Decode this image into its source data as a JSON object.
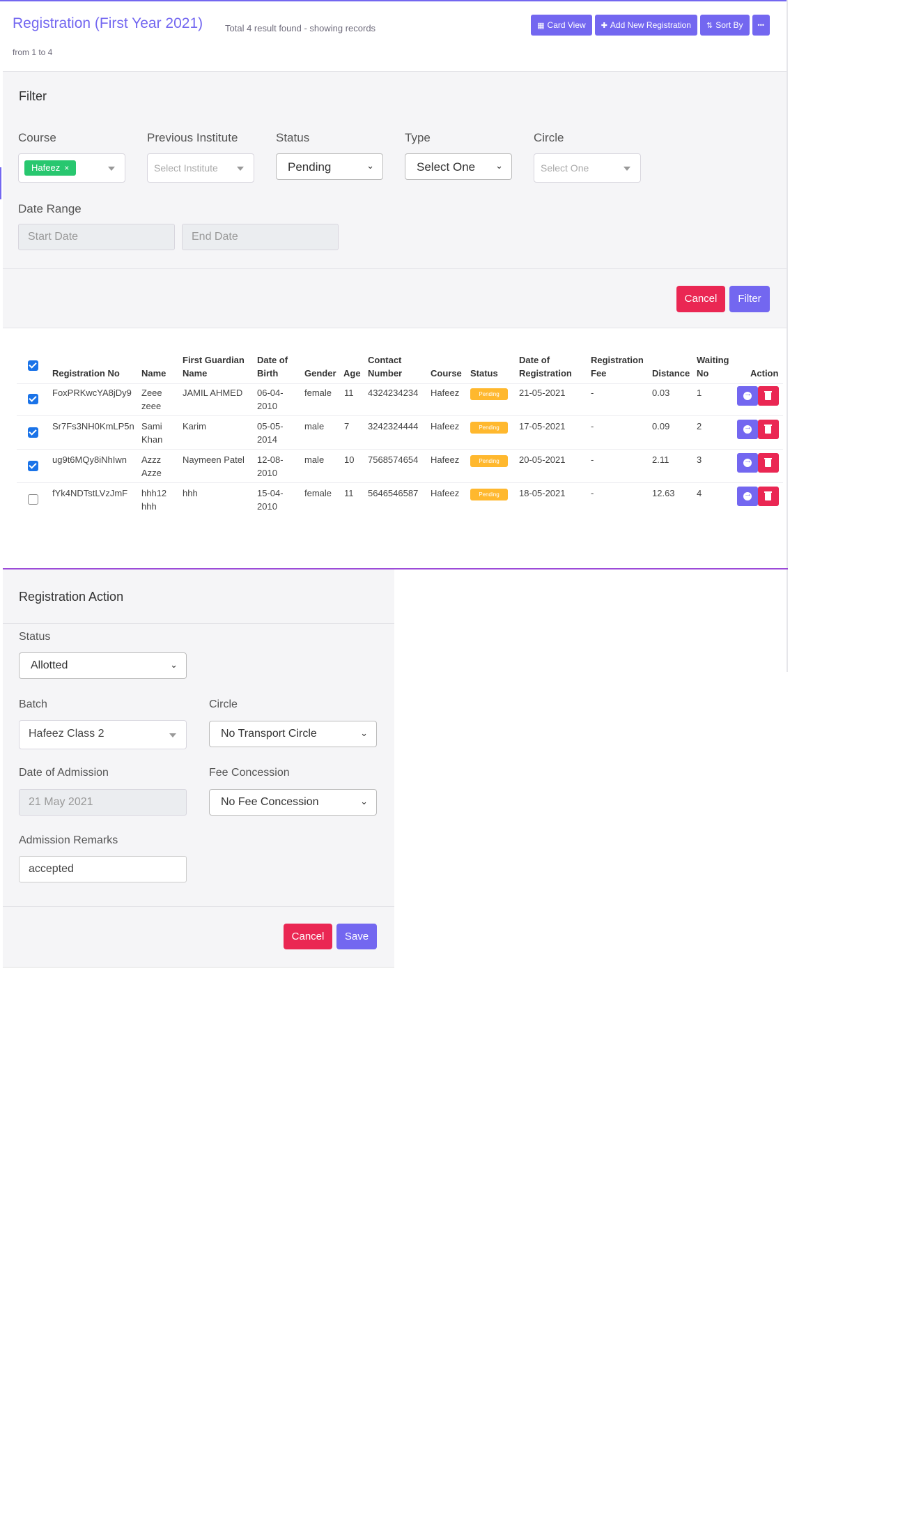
{
  "header": {
    "title": "Registration (First Year 2021)",
    "result_line1": "Total 4 result found - showing records",
    "result_line2": "from 1 to 4",
    "buttons": {
      "card_view": "Card View",
      "add_new": "Add New Registration",
      "sort_by": "Sort By",
      "more": "•••"
    }
  },
  "filter": {
    "title": "Filter",
    "course_label": "Course",
    "course_chip": "Hafeez",
    "prev_institute_label": "Previous Institute",
    "prev_institute_placeholder": "Select Institute",
    "status_label": "Status",
    "status_value": "Pending",
    "type_label": "Type",
    "type_value": "Select One",
    "circle_label": "Circle",
    "circle_placeholder": "Select One",
    "date_range_label": "Date Range",
    "start_placeholder": "Start Date",
    "end_placeholder": "End Date",
    "cancel": "Cancel",
    "filter_btn": "Filter"
  },
  "table": {
    "headers": {
      "reg_no": "Registration No",
      "name": "Name",
      "guardian_1": "First Guardian",
      "guardian_2": "Name",
      "dob_1": "Date of",
      "dob_2": "Birth",
      "gender": "Gender",
      "age": "Age",
      "contact_1": "Contact",
      "contact_2": "Number",
      "course": "Course",
      "status": "Status",
      "doreg_1": "Date of",
      "doreg_2": "Registration",
      "fee_1": "Registration",
      "fee_2": "Fee",
      "distance": "Distance",
      "waiting_1": "Waiting",
      "waiting_2": "No",
      "action": "Action"
    },
    "rows": [
      {
        "checked": true,
        "reg_no": "FoxPRKwcYA8jDy9",
        "name1": "Zeee",
        "name2": "zeee",
        "guardian": "JAMIL AHMED",
        "dob1": "06-04-",
        "dob2": "2010",
        "gender": "female",
        "age": "11",
        "contact": "4324234234",
        "course": "Hafeez",
        "status": "Pending",
        "doreg": "21-05-2021",
        "fee": "-",
        "distance": "0.03",
        "waiting": "1"
      },
      {
        "checked": true,
        "reg_no": "Sr7Fs3NH0KmLP5n",
        "name1": "Sami",
        "name2": "Khan",
        "guardian": "Karim",
        "dob1": "05-05-",
        "dob2": "2014",
        "gender": "male",
        "age": "7",
        "contact": "3242324444",
        "course": "Hafeez",
        "status": "Pending",
        "doreg": "17-05-2021",
        "fee": "-",
        "distance": "0.09",
        "waiting": "2"
      },
      {
        "checked": true,
        "reg_no": "ug9t6MQy8iNhIwn",
        "name1": "Azzz",
        "name2": "Azze",
        "guardian": "Naymeen Patel",
        "dob1": "12-08-",
        "dob2": "2010",
        "gender": "male",
        "age": "10",
        "contact": "7568574654",
        "course": "Hafeez",
        "status": "Pending",
        "doreg": "20-05-2021",
        "fee": "-",
        "distance": "2.11",
        "waiting": "3"
      },
      {
        "checked": false,
        "reg_no": "fYk4NDTstLVzJmF",
        "name1": "hhh12",
        "name2": "hhh",
        "guardian": "hhh",
        "dob1": "15-04-",
        "dob2": "2010",
        "gender": "female",
        "age": "11",
        "contact": "5646546587",
        "course": "Hafeez",
        "status": "Pending",
        "doreg": "18-05-2021",
        "fee": "-",
        "distance": "12.63",
        "waiting": "4"
      }
    ]
  },
  "registration_action": {
    "title": "Registration Action",
    "status_label": "Status",
    "status_value": "Allotted",
    "batch_label": "Batch",
    "batch_value": "Hafeez Class 2",
    "circle_label": "Circle",
    "circle_value": "No Transport Circle",
    "doa_label": "Date of Admission",
    "doa_value": "21 May 2021",
    "fee_label": "Fee Concession",
    "fee_value": "No Fee Concession",
    "remarks_label": "Admission Remarks",
    "remarks_value": "accepted",
    "cancel": "Cancel",
    "save": "Save"
  },
  "colors": {
    "primary": "#7367f0",
    "danger": "#ea2753",
    "success": "#28c76f",
    "warning": "#ffb82e"
  }
}
